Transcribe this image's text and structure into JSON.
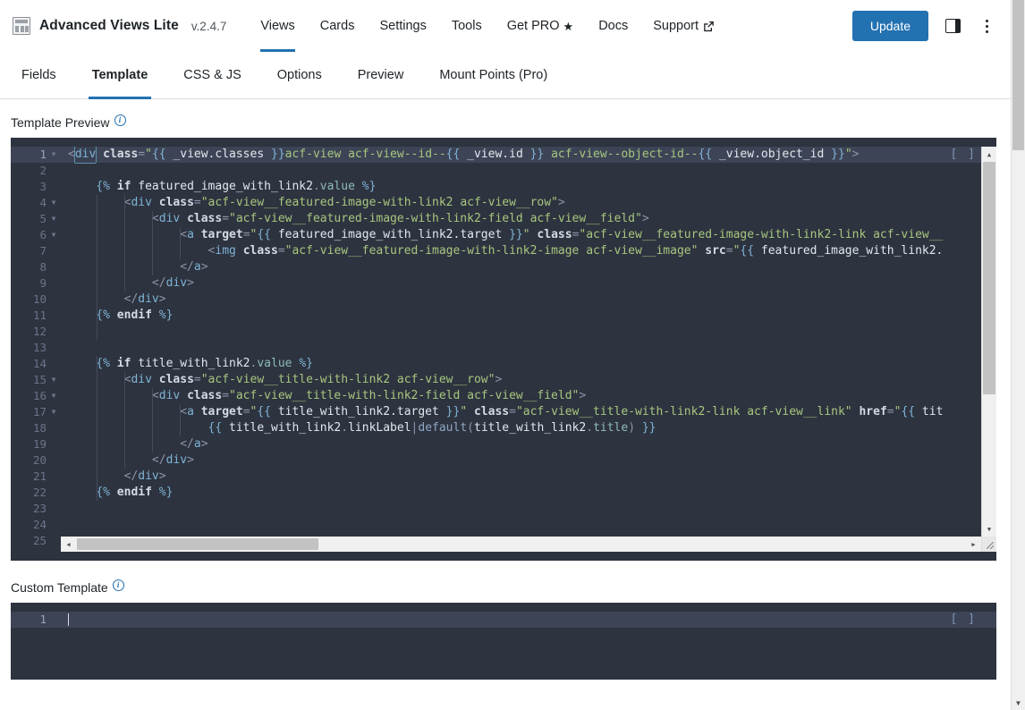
{
  "header": {
    "logo_icon": "grid-layout-icon",
    "title": "Advanced Views Lite",
    "version": "v.2.4.7",
    "nav": [
      {
        "label": "Views",
        "active": true,
        "icon": null
      },
      {
        "label": "Cards",
        "active": false,
        "icon": null
      },
      {
        "label": "Settings",
        "active": false,
        "icon": null
      },
      {
        "label": "Tools",
        "active": false,
        "icon": null
      },
      {
        "label": "Get PRO",
        "active": false,
        "icon": "star-icon"
      },
      {
        "label": "Docs",
        "active": false,
        "icon": null
      },
      {
        "label": "Support",
        "active": false,
        "icon": "external-link-icon"
      }
    ],
    "update_label": "Update",
    "accent_color": "#2271b1",
    "panel_toggle_icon": "sidebar-panel-icon",
    "menu_icon": "kebab-menu-icon"
  },
  "subtabs": [
    {
      "label": "Fields",
      "active": false
    },
    {
      "label": "Template",
      "active": true
    },
    {
      "label": "CSS & JS",
      "active": false
    },
    {
      "label": "Options",
      "active": false
    },
    {
      "label": "Preview",
      "active": false
    },
    {
      "label": "Mount Points (Pro)",
      "active": false
    }
  ],
  "sections": {
    "preview": {
      "label": "Template Preview",
      "info_icon": "info-icon",
      "bracket_marker": "[ ]",
      "total_lines": 25,
      "active_line": 1
    },
    "custom": {
      "label": "Custom Template",
      "info_icon": "info-icon",
      "bracket_marker": "[ ]",
      "total_lines": 1,
      "active_line": 1,
      "value": ""
    }
  },
  "code_lines": [
    {
      "n": 1,
      "fold": true,
      "active": true,
      "tokens": [
        {
          "t": "<",
          "c": "t-punc"
        },
        {
          "t": "div",
          "c": "t-tag taghl"
        },
        {
          "t": " ",
          "c": "t-plain"
        },
        {
          "t": "class",
          "c": "t-attr"
        },
        {
          "t": "=",
          "c": "t-punc"
        },
        {
          "t": "\"",
          "c": "t-str"
        },
        {
          "t": "{{",
          "c": "t-tw"
        },
        {
          "t": " _view.classes ",
          "c": "t-var"
        },
        {
          "t": "}}",
          "c": "t-tw"
        },
        {
          "t": "acf-view acf-view--id--",
          "c": "t-str"
        },
        {
          "t": "{{",
          "c": "t-tw"
        },
        {
          "t": " _view.id ",
          "c": "t-var"
        },
        {
          "t": "}}",
          "c": "t-tw"
        },
        {
          "t": " acf-view--object-id--",
          "c": "t-str"
        },
        {
          "t": "{{",
          "c": "t-tw"
        },
        {
          "t": " _view.object_id ",
          "c": "t-var"
        },
        {
          "t": "}}",
          "c": "t-tw"
        },
        {
          "t": "\"",
          "c": "t-str"
        },
        {
          "t": ">",
          "c": "t-punc"
        }
      ]
    },
    {
      "n": 2,
      "fold": false,
      "active": false,
      "tokens": []
    },
    {
      "n": 3,
      "fold": false,
      "active": false,
      "tokens": [
        {
          "t": "    ",
          "c": "t-plain"
        },
        {
          "t": "{%",
          "c": "t-tw"
        },
        {
          "t": " ",
          "c": "t-plain"
        },
        {
          "t": "if",
          "c": "t-attr"
        },
        {
          "t": " ",
          "c": "t-plain"
        },
        {
          "t": "featured_image_with_link2",
          "c": "t-var"
        },
        {
          "t": ".",
          "c": "t-punc"
        },
        {
          "t": "value",
          "c": "t-prop"
        },
        {
          "t": " ",
          "c": "t-plain"
        },
        {
          "t": "%}",
          "c": "t-tw"
        }
      ]
    },
    {
      "n": 4,
      "fold": true,
      "active": false,
      "tokens": [
        {
          "t": "        ",
          "c": "t-plain"
        },
        {
          "t": "<",
          "c": "t-punc"
        },
        {
          "t": "div",
          "c": "t-tag"
        },
        {
          "t": " ",
          "c": "t-plain"
        },
        {
          "t": "class",
          "c": "t-attr"
        },
        {
          "t": "=",
          "c": "t-punc"
        },
        {
          "t": "\"acf-view__featured-image-with-link2 acf-view__row\"",
          "c": "t-str"
        },
        {
          "t": ">",
          "c": "t-punc"
        }
      ]
    },
    {
      "n": 5,
      "fold": true,
      "active": false,
      "tokens": [
        {
          "t": "            ",
          "c": "t-plain"
        },
        {
          "t": "<",
          "c": "t-punc"
        },
        {
          "t": "div",
          "c": "t-tag"
        },
        {
          "t": " ",
          "c": "t-plain"
        },
        {
          "t": "class",
          "c": "t-attr"
        },
        {
          "t": "=",
          "c": "t-punc"
        },
        {
          "t": "\"acf-view__featured-image-with-link2-field acf-view__field\"",
          "c": "t-str"
        },
        {
          "t": ">",
          "c": "t-punc"
        }
      ]
    },
    {
      "n": 6,
      "fold": true,
      "active": false,
      "tokens": [
        {
          "t": "                ",
          "c": "t-plain"
        },
        {
          "t": "<",
          "c": "t-punc"
        },
        {
          "t": "a",
          "c": "t-tag"
        },
        {
          "t": " ",
          "c": "t-plain"
        },
        {
          "t": "target",
          "c": "t-attr"
        },
        {
          "t": "=",
          "c": "t-punc"
        },
        {
          "t": "\"",
          "c": "t-str"
        },
        {
          "t": "{{",
          "c": "t-tw"
        },
        {
          "t": " featured_image_with_link2.target ",
          "c": "t-var"
        },
        {
          "t": "}}",
          "c": "t-tw"
        },
        {
          "t": "\"",
          "c": "t-str"
        },
        {
          "t": " ",
          "c": "t-plain"
        },
        {
          "t": "class",
          "c": "t-attr"
        },
        {
          "t": "=",
          "c": "t-punc"
        },
        {
          "t": "\"acf-view__featured-image-with-link2-link acf-view__",
          "c": "t-str"
        }
      ]
    },
    {
      "n": 7,
      "fold": false,
      "active": false,
      "tokens": [
        {
          "t": "                    ",
          "c": "t-plain"
        },
        {
          "t": "<",
          "c": "t-punc"
        },
        {
          "t": "img",
          "c": "t-tag"
        },
        {
          "t": " ",
          "c": "t-plain"
        },
        {
          "t": "class",
          "c": "t-attr"
        },
        {
          "t": "=",
          "c": "t-punc"
        },
        {
          "t": "\"acf-view__featured-image-with-link2-image acf-view__image\"",
          "c": "t-str"
        },
        {
          "t": " ",
          "c": "t-plain"
        },
        {
          "t": "src",
          "c": "t-attr"
        },
        {
          "t": "=",
          "c": "t-punc"
        },
        {
          "t": "\"",
          "c": "t-str"
        },
        {
          "t": "{{",
          "c": "t-tw"
        },
        {
          "t": " featured_image_with_link2.",
          "c": "t-var"
        }
      ]
    },
    {
      "n": 8,
      "fold": false,
      "active": false,
      "tokens": [
        {
          "t": "                ",
          "c": "t-plain"
        },
        {
          "t": "</",
          "c": "t-punc"
        },
        {
          "t": "a",
          "c": "t-tag"
        },
        {
          "t": ">",
          "c": "t-punc"
        }
      ]
    },
    {
      "n": 9,
      "fold": false,
      "active": false,
      "tokens": [
        {
          "t": "            ",
          "c": "t-plain"
        },
        {
          "t": "</",
          "c": "t-punc"
        },
        {
          "t": "div",
          "c": "t-tag"
        },
        {
          "t": ">",
          "c": "t-punc"
        }
      ]
    },
    {
      "n": 10,
      "fold": false,
      "active": false,
      "tokens": [
        {
          "t": "        ",
          "c": "t-plain"
        },
        {
          "t": "</",
          "c": "t-punc"
        },
        {
          "t": "div",
          "c": "t-tag"
        },
        {
          "t": ">",
          "c": "t-punc"
        }
      ]
    },
    {
      "n": 11,
      "fold": false,
      "active": false,
      "tokens": [
        {
          "t": "    ",
          "c": "t-plain"
        },
        {
          "t": "{%",
          "c": "t-tw"
        },
        {
          "t": " ",
          "c": "t-plain"
        },
        {
          "t": "endif",
          "c": "t-attr"
        },
        {
          "t": " ",
          "c": "t-plain"
        },
        {
          "t": "%}",
          "c": "t-tw"
        }
      ]
    },
    {
      "n": 12,
      "fold": false,
      "active": false,
      "tokens": []
    },
    {
      "n": 13,
      "fold": false,
      "active": false,
      "tokens": []
    },
    {
      "n": 14,
      "fold": false,
      "active": false,
      "tokens": [
        {
          "t": "    ",
          "c": "t-plain"
        },
        {
          "t": "{%",
          "c": "t-tw"
        },
        {
          "t": " ",
          "c": "t-plain"
        },
        {
          "t": "if",
          "c": "t-attr"
        },
        {
          "t": " ",
          "c": "t-plain"
        },
        {
          "t": "title_with_link2",
          "c": "t-var"
        },
        {
          "t": ".",
          "c": "t-punc"
        },
        {
          "t": "value",
          "c": "t-prop"
        },
        {
          "t": " ",
          "c": "t-plain"
        },
        {
          "t": "%}",
          "c": "t-tw"
        }
      ]
    },
    {
      "n": 15,
      "fold": true,
      "active": false,
      "tokens": [
        {
          "t": "        ",
          "c": "t-plain"
        },
        {
          "t": "<",
          "c": "t-punc"
        },
        {
          "t": "div",
          "c": "t-tag"
        },
        {
          "t": " ",
          "c": "t-plain"
        },
        {
          "t": "class",
          "c": "t-attr"
        },
        {
          "t": "=",
          "c": "t-punc"
        },
        {
          "t": "\"acf-view__title-with-link2 acf-view__row\"",
          "c": "t-str"
        },
        {
          "t": ">",
          "c": "t-punc"
        }
      ]
    },
    {
      "n": 16,
      "fold": true,
      "active": false,
      "tokens": [
        {
          "t": "            ",
          "c": "t-plain"
        },
        {
          "t": "<",
          "c": "t-punc"
        },
        {
          "t": "div",
          "c": "t-tag"
        },
        {
          "t": " ",
          "c": "t-plain"
        },
        {
          "t": "class",
          "c": "t-attr"
        },
        {
          "t": "=",
          "c": "t-punc"
        },
        {
          "t": "\"acf-view__title-with-link2-field acf-view__field\"",
          "c": "t-str"
        },
        {
          "t": ">",
          "c": "t-punc"
        }
      ]
    },
    {
      "n": 17,
      "fold": true,
      "active": false,
      "tokens": [
        {
          "t": "                ",
          "c": "t-plain"
        },
        {
          "t": "<",
          "c": "t-punc"
        },
        {
          "t": "a",
          "c": "t-tag"
        },
        {
          "t": " ",
          "c": "t-plain"
        },
        {
          "t": "target",
          "c": "t-attr"
        },
        {
          "t": "=",
          "c": "t-punc"
        },
        {
          "t": "\"",
          "c": "t-str"
        },
        {
          "t": "{{",
          "c": "t-tw"
        },
        {
          "t": " title_with_link2.target ",
          "c": "t-var"
        },
        {
          "t": "}}",
          "c": "t-tw"
        },
        {
          "t": "\"",
          "c": "t-str"
        },
        {
          "t": " ",
          "c": "t-plain"
        },
        {
          "t": "class",
          "c": "t-attr"
        },
        {
          "t": "=",
          "c": "t-punc"
        },
        {
          "t": "\"acf-view__title-with-link2-link acf-view__link\"",
          "c": "t-str"
        },
        {
          "t": " ",
          "c": "t-plain"
        },
        {
          "t": "href",
          "c": "t-attr"
        },
        {
          "t": "=",
          "c": "t-punc"
        },
        {
          "t": "\"",
          "c": "t-str"
        },
        {
          "t": "{{",
          "c": "t-tw"
        },
        {
          "t": " tit",
          "c": "t-var"
        }
      ]
    },
    {
      "n": 18,
      "fold": false,
      "active": false,
      "tokens": [
        {
          "t": "                    ",
          "c": "t-plain"
        },
        {
          "t": "{{",
          "c": "t-tw"
        },
        {
          "t": " ",
          "c": "t-plain"
        },
        {
          "t": "title_with_link2",
          "c": "t-var"
        },
        {
          "t": ".",
          "c": "t-punc"
        },
        {
          "t": "linkLabel",
          "c": "t-var"
        },
        {
          "t": "|",
          "c": "t-punc"
        },
        {
          "t": "default",
          "c": "t-fn"
        },
        {
          "t": "(",
          "c": "t-punc"
        },
        {
          "t": "title_with_link2",
          "c": "t-var"
        },
        {
          "t": ".",
          "c": "t-punc"
        },
        {
          "t": "title",
          "c": "t-prop"
        },
        {
          "t": ")",
          "c": "t-punc"
        },
        {
          "t": " ",
          "c": "t-plain"
        },
        {
          "t": "}}",
          "c": "t-tw"
        }
      ]
    },
    {
      "n": 19,
      "fold": false,
      "active": false,
      "tokens": [
        {
          "t": "                ",
          "c": "t-plain"
        },
        {
          "t": "</",
          "c": "t-punc"
        },
        {
          "t": "a",
          "c": "t-tag"
        },
        {
          "t": ">",
          "c": "t-punc"
        }
      ]
    },
    {
      "n": 20,
      "fold": false,
      "active": false,
      "tokens": [
        {
          "t": "            ",
          "c": "t-plain"
        },
        {
          "t": "</",
          "c": "t-punc"
        },
        {
          "t": "div",
          "c": "t-tag"
        },
        {
          "t": ">",
          "c": "t-punc"
        }
      ]
    },
    {
      "n": 21,
      "fold": false,
      "active": false,
      "tokens": [
        {
          "t": "        ",
          "c": "t-plain"
        },
        {
          "t": "</",
          "c": "t-punc"
        },
        {
          "t": "div",
          "c": "t-tag"
        },
        {
          "t": ">",
          "c": "t-punc"
        }
      ]
    },
    {
      "n": 22,
      "fold": false,
      "active": false,
      "tokens": [
        {
          "t": "    ",
          "c": "t-plain"
        },
        {
          "t": "{%",
          "c": "t-tw"
        },
        {
          "t": " ",
          "c": "t-plain"
        },
        {
          "t": "endif",
          "c": "t-attr"
        },
        {
          "t": " ",
          "c": "t-plain"
        },
        {
          "t": "%}",
          "c": "t-tw"
        }
      ]
    },
    {
      "n": 23,
      "fold": false,
      "active": false,
      "tokens": []
    },
    {
      "n": 24,
      "fold": false,
      "active": false,
      "tokens": []
    },
    {
      "n": 25,
      "fold": false,
      "active": false,
      "tokens": []
    }
  ]
}
